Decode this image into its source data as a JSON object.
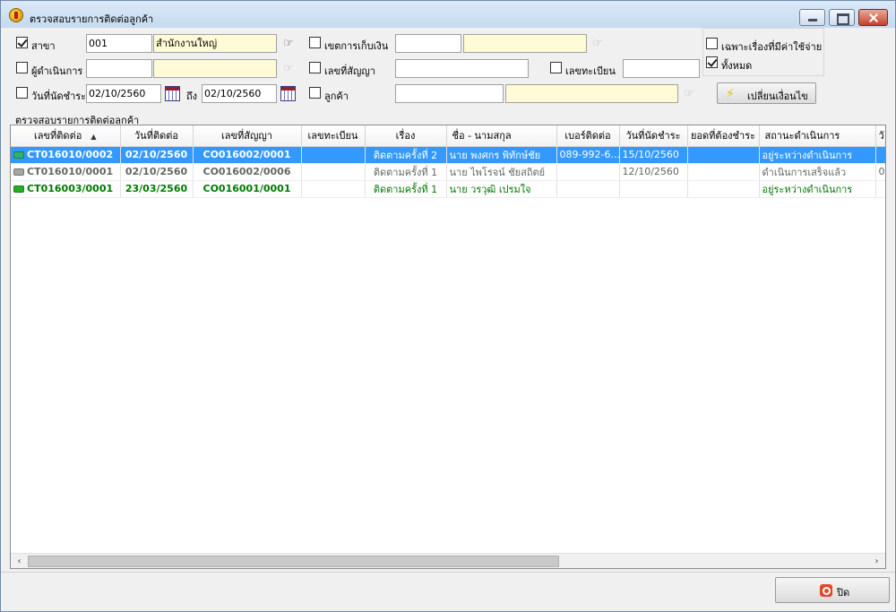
{
  "window": {
    "title": "ตรวจสอบรายการติดต่อลูกค้า"
  },
  "filters": {
    "branch": {
      "label": "สาขา",
      "checked": true,
      "code": "001",
      "name": "สำนักงานใหญ่"
    },
    "operator": {
      "label": "ผู้ดำเนินการ",
      "checked": false,
      "code": "",
      "name": ""
    },
    "due_date": {
      "label": "วันที่นัดชำระ",
      "checked": false,
      "from": "02/10/2560",
      "to_label": "ถึง",
      "to": "02/10/2560"
    },
    "collection_zone": {
      "label": "เขตการเก็บเงิน",
      "checked": false,
      "code": "",
      "name": ""
    },
    "contract_no": {
      "label": "เลขที่สัญญา",
      "checked": false,
      "value": ""
    },
    "registration": {
      "label": "เลขทะเบียน",
      "checked": false,
      "value": ""
    },
    "customer": {
      "label": "ลูกค้า",
      "checked": false,
      "code": "",
      "name": ""
    },
    "only_with_expense": {
      "label": "เฉพาะเรื่องที่มีค่าใช้จ่าย",
      "checked": false
    },
    "all": {
      "label": "ทั้งหมด",
      "checked": true
    },
    "change_condition_label": "เปลี่ยนเงื่อนไข"
  },
  "grid": {
    "section_title": "ตรวจสอบรายการติดต่อลูกค้า",
    "columns": [
      "เลขที่ติดต่อ",
      "วันที่ติดต่อ",
      "เลขที่สัญญา",
      "เลขทะเบียน",
      "เรื่อง",
      "ชื่อ - นามสกุล",
      "เบอร์ติดต่อ",
      "วันที่นัดชำระ",
      "ยอดที่ต้องชำระ",
      "สถานะดำเนินการ",
      "วั"
    ],
    "rows": [
      {
        "contact_no": "CT016010/0002",
        "contact_date": "02/10/2560",
        "contract_no": "CO016002/0001",
        "registration": "",
        "subject": "ติดตามครั้งที่ 2",
        "name": "นาย พงศกร พิทักษ์ชัย",
        "phone": "089-992-6...",
        "due_date": "15/10/2560",
        "amount": "",
        "status": "อยู่ระหว่างดำเนินการ",
        "extra": "",
        "dot_color": "#2fb36b"
      },
      {
        "contact_no": "CT016010/0001",
        "contact_date": "02/10/2560",
        "contract_no": "CO016002/0006",
        "registration": "",
        "subject": "ติดตามครั้งที่ 1",
        "name": "นาย ไพโรจน์ ชัยสถิตย์",
        "phone": "",
        "due_date": "12/10/2560",
        "amount": "",
        "status": "ดำเนินการเสร็จแล้ว",
        "extra": "0",
        "dot_color": "#a6a6a6"
      },
      {
        "contact_no": "CT016003/0001",
        "contact_date": "23/03/2560",
        "contract_no": "CO016001/0001",
        "registration": "",
        "subject": "ติดตามครั้งที่ 1",
        "name": "นาย วรวุฒิ เปรมใจ",
        "phone": "",
        "due_date": "",
        "amount": "",
        "status": "อยู่ระหว่างดำเนินการ",
        "extra": "",
        "dot_color": "#22b022"
      }
    ]
  },
  "footer": {
    "close_label": "ปิด"
  },
  "colors": {
    "selection": "#3399ff",
    "row_green": "#007a00",
    "row_gray": "#666666",
    "lookup_yellow": "#fffbd6"
  }
}
